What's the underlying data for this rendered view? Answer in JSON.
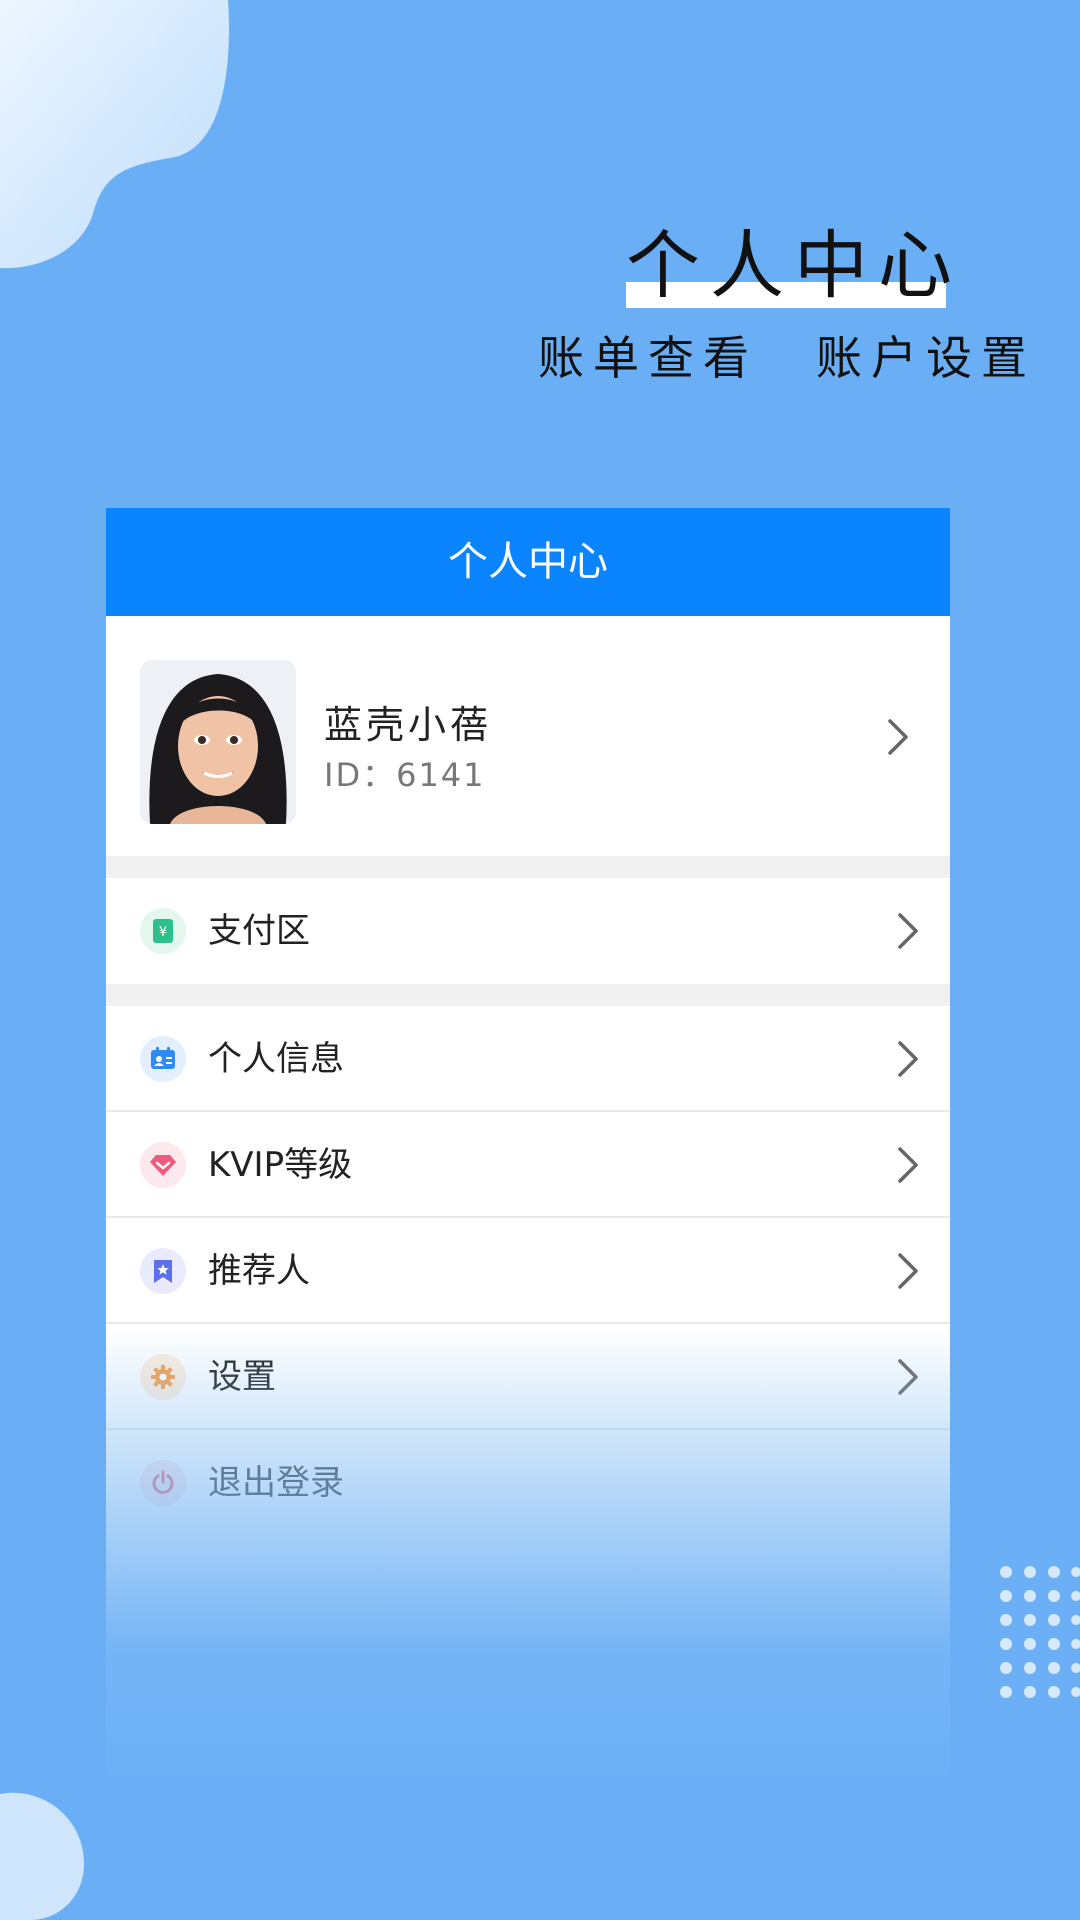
{
  "promo": {
    "title": "个人中心",
    "subtitle_left": "账单查看",
    "subtitle_right": "账户设置"
  },
  "header": {
    "title": "个人中心"
  },
  "profile": {
    "name": "蓝壳小蓓",
    "id_text": "ID：6141"
  },
  "menu_payment": {
    "label": "支付区",
    "icon": "wallet-icon",
    "icon_color": "#2cc08a"
  },
  "menu": [
    {
      "label": "个人信息",
      "icon": "id-card-icon",
      "icon_color": "#2f8af5"
    },
    {
      "label": "KVIP等级",
      "icon": "diamond-icon",
      "icon_color": "#f05a7e"
    },
    {
      "label": "推荐人",
      "icon": "bookmark-star-icon",
      "icon_color": "#5b6ff0"
    },
    {
      "label": "设置",
      "icon": "gear-icon",
      "icon_color": "#f5a04a"
    },
    {
      "label": "退出登录",
      "icon": "power-icon",
      "icon_color": "#e8646e"
    }
  ],
  "colors": {
    "header": "#0a84ff",
    "background": "#6aaff5"
  }
}
